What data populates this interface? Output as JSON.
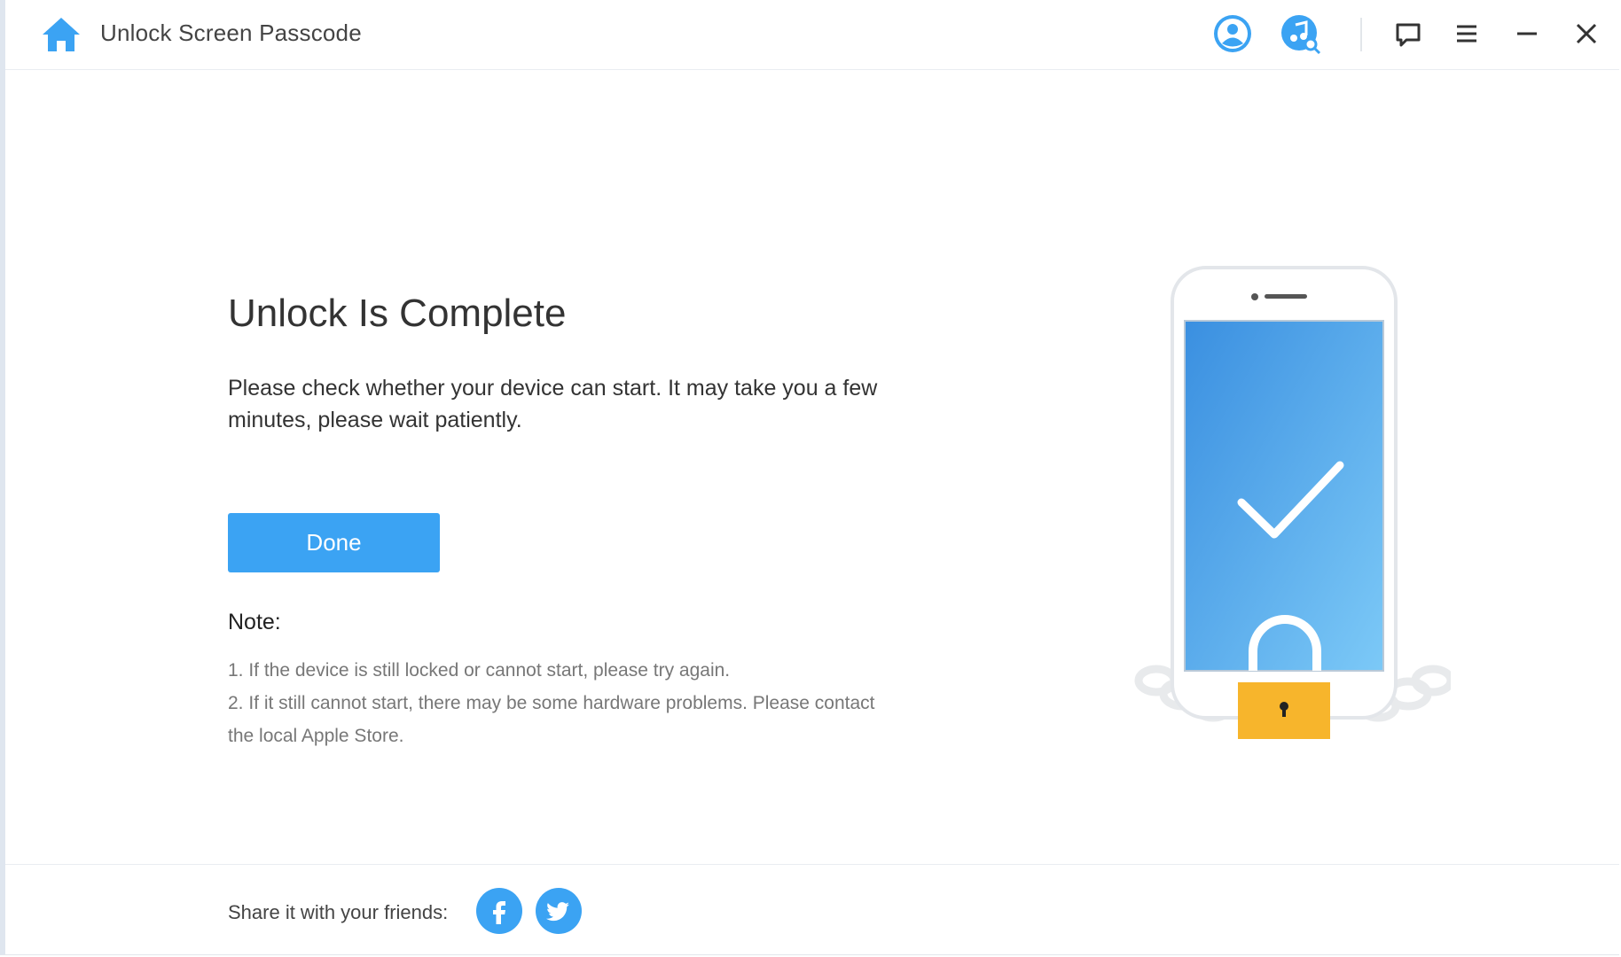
{
  "titlebar": {
    "title": "Unlock Screen Passcode",
    "icons": [
      "home-icon",
      "account-icon",
      "music-search-icon",
      "feedback-icon",
      "menu-icon",
      "minimize-icon",
      "close-icon"
    ]
  },
  "main": {
    "heading": "Unlock Is Complete",
    "description": "Please check whether your device can start. It may take you a few minutes, please wait patiently.",
    "done_label": "Done",
    "note_title": "Note:",
    "notes": [
      "1. If the device is still locked or cannot start, please try again.",
      "2. If it still cannot start, there may be some hardware problems. Please contact the local Apple Store."
    ]
  },
  "footer": {
    "share_label": "Share it with your friends:",
    "social": [
      "facebook-icon",
      "twitter-icon"
    ]
  },
  "colors": {
    "accent": "#3ba3f3",
    "lock": "#f7b52c",
    "text": "#333333",
    "muted": "#777777"
  }
}
